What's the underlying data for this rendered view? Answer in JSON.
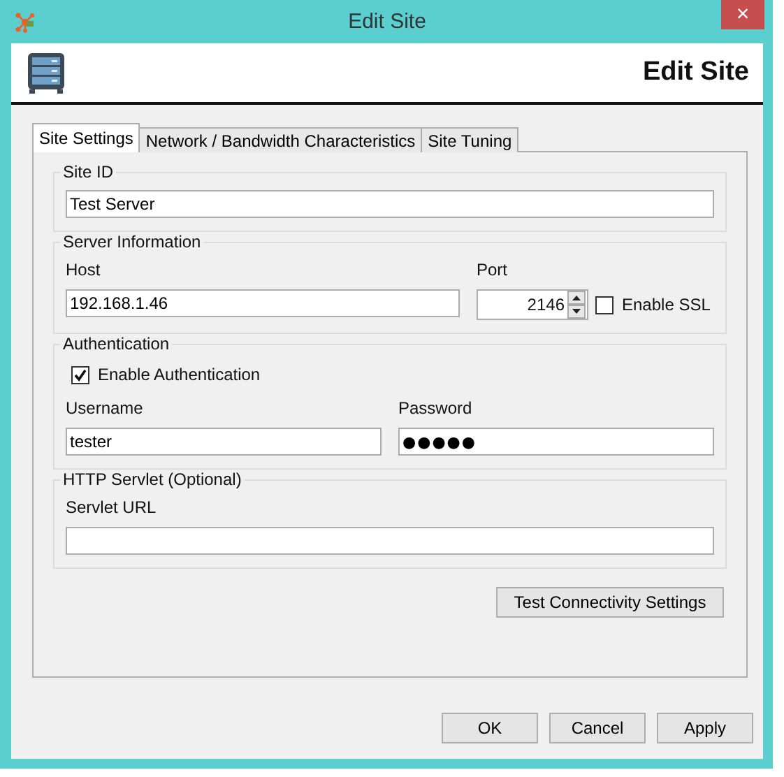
{
  "window": {
    "title": "Edit Site",
    "close": "×"
  },
  "header": {
    "title": "Edit Site"
  },
  "tabs": [
    {
      "label": "Site Settings",
      "selected": true
    },
    {
      "label": "Network / Bandwidth Characteristics",
      "selected": false
    },
    {
      "label": "Site Tuning",
      "selected": false
    }
  ],
  "site_id": {
    "legend": "Site ID",
    "value": "Test Server"
  },
  "server_information": {
    "legend": "Server Information",
    "host_label": "Host",
    "host": "192.168.1.46",
    "port_label": "Port",
    "port": "2146",
    "ssl": {
      "label": "Enable SSL",
      "checked": false
    }
  },
  "authentication": {
    "legend": "Authentication",
    "enable": {
      "label": "Enable Authentication",
      "checked": true
    },
    "username_label": "Username",
    "username": "tester",
    "password_label": "Password",
    "password": "●●●●●"
  },
  "http_servlet": {
    "legend": "HTTP Servlet (Optional)",
    "url_label": "Servlet URL"
  },
  "test_button": "Test Connectivity Settings",
  "buttons": [
    "OK",
    "Cancel",
    "Apply"
  ]
}
